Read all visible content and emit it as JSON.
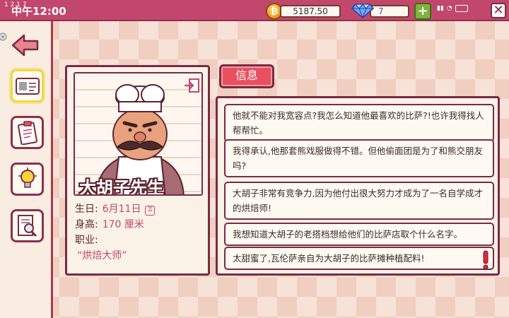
{
  "status_bar": {
    "top_left_text": "1 2 1 7",
    "time": "中午12:00"
  },
  "currency": {
    "coins": "5187.50",
    "gems": "7",
    "add_label": "+"
  },
  "sidebar": {
    "items": [
      {
        "icon": "id-card-icon",
        "active": true
      },
      {
        "icon": "clipboard-icon",
        "active": false
      },
      {
        "icon": "lightbulb-icon",
        "active": false
      },
      {
        "icon": "magnifier-notes-icon",
        "active": false
      }
    ]
  },
  "character": {
    "name": "大胡子先生",
    "birthday_label": "生日:",
    "birthday": "6月11日",
    "zodiac_glyph": "♊",
    "height_label": "身高:",
    "height": "170 厘米",
    "job_label": "职业:",
    "job": "“烘焙大师”"
  },
  "info": {
    "tab_label": "信息",
    "entries": [
      "他就不能对我宽容点?我怎么知道他最喜欢的比萨?!也许我得找人帮帮忙。",
      "我得承认,他那套熊戏服做得不错。但他偷面团是为了和熊交朋友吗?",
      "大胡子非常有竞争力,因为他付出很大努力才成为了一名自学成才的烘焙师!",
      "我想知道大胡子的老搭档想给他们的比萨店取个什么名字。",
      "太甜蜜了,瓦伦萨亲自为大胡子的比萨摊种植配料!"
    ]
  },
  "colors": {
    "accent": "#c2476c",
    "border": "#7a2b44",
    "tab": "#e8505f",
    "alert": "#e0283a"
  }
}
